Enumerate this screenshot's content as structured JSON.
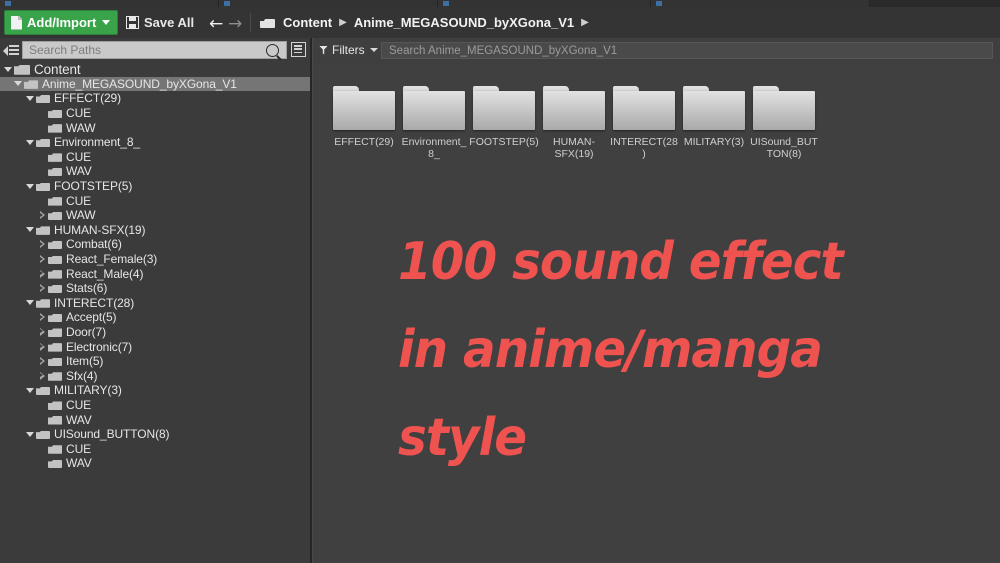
{
  "window": {
    "top_tabs": [
      "",
      "",
      "",
      ""
    ]
  },
  "toolbar": {
    "add_import_label": "Add/Import",
    "add_import_icon": "new-page-icon",
    "add_import_caret": "chevron-down-icon",
    "save_all_label": "Save All",
    "save_all_icon": "floppy-disk-icon",
    "back_arrow": "←",
    "forward_arrow": "→",
    "breadcrumb_icon": "folder-icon",
    "breadcrumb": [
      "Content",
      "Anime_MEGASOUND_byXGona_V1"
    ],
    "breadcrumb_separator": "▶",
    "breadcrumb_trailing_separator": "▶",
    "accent_green": "#38a349"
  },
  "sources_panel": {
    "collapse_icon": "collapse-panel-icon",
    "search_placeholder": "Search Paths",
    "search_value": "",
    "search_icon": "search-icon",
    "options_icon": "list-options-icon",
    "tree": [
      {
        "label": "Content",
        "depth": 0,
        "state": "expanded",
        "selected": false
      },
      {
        "label": "Anime_MEGASOUND_byXGona_V1",
        "depth": 1,
        "state": "expanded",
        "selected": true
      },
      {
        "label": "EFFECT(29)",
        "depth": 2,
        "state": "expanded",
        "selected": false
      },
      {
        "label": "CUE",
        "depth": 3,
        "state": "leaf",
        "selected": false
      },
      {
        "label": "WAW",
        "depth": 3,
        "state": "leaf",
        "selected": false
      },
      {
        "label": "Environment_8_",
        "depth": 2,
        "state": "expanded",
        "selected": false
      },
      {
        "label": "CUE",
        "depth": 3,
        "state": "leaf",
        "selected": false
      },
      {
        "label": "WAV",
        "depth": 3,
        "state": "leaf",
        "selected": false
      },
      {
        "label": "FOOTSTEP(5)",
        "depth": 2,
        "state": "expanded",
        "selected": false
      },
      {
        "label": "CUE",
        "depth": 3,
        "state": "leaf",
        "selected": false
      },
      {
        "label": "WAW",
        "depth": 3,
        "state": "collapsed",
        "selected": false
      },
      {
        "label": "HUMAN-SFX(19)",
        "depth": 2,
        "state": "expanded",
        "selected": false
      },
      {
        "label": "Combat(6)",
        "depth": 3,
        "state": "collapsed",
        "selected": false
      },
      {
        "label": "React_Female(3)",
        "depth": 3,
        "state": "collapsed",
        "selected": false
      },
      {
        "label": "React_Male(4)",
        "depth": 3,
        "state": "collapsed",
        "selected": false
      },
      {
        "label": "Stats(6)",
        "depth": 3,
        "state": "collapsed",
        "selected": false
      },
      {
        "label": "INTERECT(28)",
        "depth": 2,
        "state": "expanded",
        "selected": false
      },
      {
        "label": "Accept(5)",
        "depth": 3,
        "state": "collapsed",
        "selected": false
      },
      {
        "label": "Door(7)",
        "depth": 3,
        "state": "collapsed",
        "selected": false
      },
      {
        "label": "Electronic(7)",
        "depth": 3,
        "state": "collapsed",
        "selected": false
      },
      {
        "label": "Item(5)",
        "depth": 3,
        "state": "collapsed",
        "selected": false
      },
      {
        "label": "Sfx(4)",
        "depth": 3,
        "state": "collapsed",
        "selected": false
      },
      {
        "label": "MILITARY(3)",
        "depth": 2,
        "state": "expanded",
        "selected": false
      },
      {
        "label": "CUE",
        "depth": 3,
        "state": "leaf",
        "selected": false
      },
      {
        "label": "WAV",
        "depth": 3,
        "state": "leaf",
        "selected": false
      },
      {
        "label": "UISound_BUTTON(8)",
        "depth": 2,
        "state": "expanded",
        "selected": false
      },
      {
        "label": "CUE",
        "depth": 3,
        "state": "leaf",
        "selected": false
      },
      {
        "label": "WAV",
        "depth": 3,
        "state": "leaf",
        "selected": false
      }
    ]
  },
  "asset_view": {
    "filters_label": "Filters",
    "filters_icon": "funnel-icon",
    "filters_caret": "chevron-down-icon",
    "search_placeholder": "Search Anime_MEGASOUND_byXGona_V1",
    "search_value": "",
    "folders": [
      {
        "label": "EFFECT(29)",
        "icon": "folder-icon"
      },
      {
        "label": "Environment_8_",
        "icon": "folder-icon"
      },
      {
        "label": "FOOTSTEP(5)",
        "icon": "folder-icon"
      },
      {
        "label": "HUMAN-SFX(19)",
        "icon": "folder-icon"
      },
      {
        "label": "INTERECT(28)",
        "icon": "folder-icon"
      },
      {
        "label": "MILITARY(3)",
        "icon": "folder-icon"
      },
      {
        "label": "UISound_BUTTON(8)",
        "icon": "folder-icon"
      }
    ]
  },
  "overlay": {
    "color": "#ef5350",
    "lines": [
      "100 sound effect",
      "in anime/manga",
      "style"
    ]
  }
}
